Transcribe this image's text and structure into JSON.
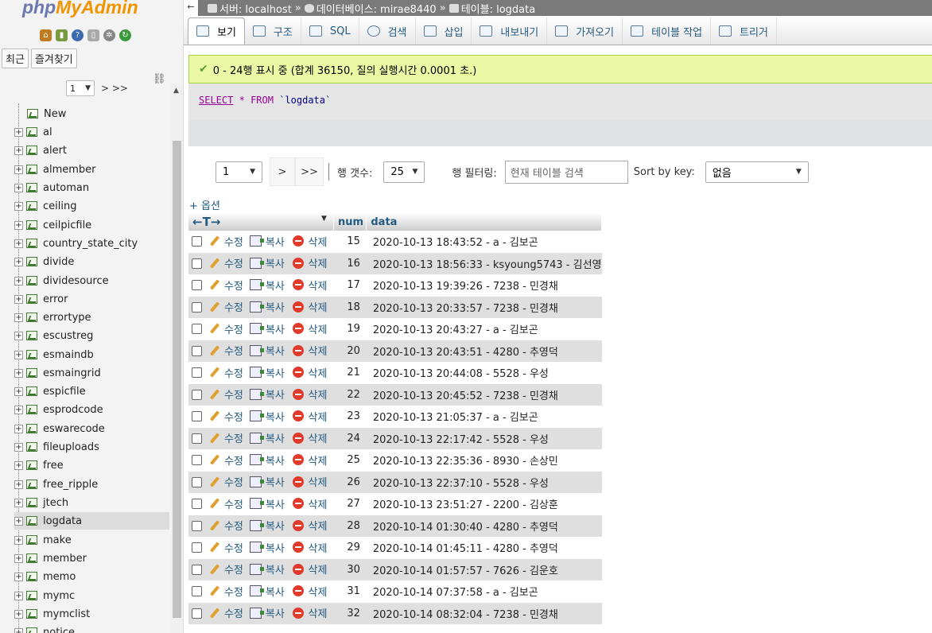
{
  "logo": {
    "php": "php",
    "myadmin": "MyAdmin"
  },
  "nav": {
    "tabs": [
      "최근",
      "즐겨찾기"
    ],
    "pager": {
      "page": "1",
      "next": "> >>"
    },
    "new_label": "New",
    "tables": [
      "al",
      "alert",
      "almember",
      "automan",
      "ceiling",
      "ceilpicfile",
      "country_state_city",
      "divide",
      "dividesource",
      "error",
      "errortype",
      "escustreg",
      "esmaindb",
      "esmaingrid",
      "espicfile",
      "esprodcode",
      "eswarecode",
      "fileuploads",
      "free",
      "free_ripple",
      "jtech",
      "logdata",
      "make",
      "member",
      "memo",
      "mymc",
      "mymclist",
      "notice"
    ],
    "active_table": "logdata"
  },
  "breadcrumb": {
    "back": "←",
    "server": "서버: localhost",
    "sep": "»",
    "database": "데이터베이스: mirae8440",
    "table": "테이블: logdata"
  },
  "tabs": [
    "보기",
    "구조",
    "SQL",
    "검색",
    "삽입",
    "내보내기",
    "가져오기",
    "테이블 작업",
    "트리거"
  ],
  "success": "0 - 24행 표시 중 (합계 36150, 질의 실행시간 0.0001 초.)",
  "sql": {
    "select": "SELECT",
    "star": "*",
    "from": "FROM",
    "table": "`logdata`"
  },
  "navrow": {
    "page": "1",
    "next": ">",
    "last": ">>",
    "rows_label": "행 갯수:",
    "rows_value": "25",
    "filter_label": "행 필터링:",
    "filter_placeholder": "현재 테이블 검색",
    "sort_label": "Sort by key:",
    "sort_value": "없음"
  },
  "options_label": "+ 옵션",
  "columns": {
    "arrows": "←T→",
    "num": "num",
    "data": "data"
  },
  "actions": {
    "edit": "수정",
    "copy": "복사",
    "delete": "삭제"
  },
  "rows": [
    {
      "num": "15",
      "data": "2020-10-13 18:43:52 - a - 김보곤"
    },
    {
      "num": "16",
      "data": "2020-10-13 18:56:33 - ksyoung5743 - 김선영"
    },
    {
      "num": "17",
      "data": "2020-10-13 19:39:26 - 7238 - 민경채"
    },
    {
      "num": "18",
      "data": "2020-10-13 20:33:57 - 7238 - 민경채"
    },
    {
      "num": "19",
      "data": "2020-10-13 20:43:27 - a - 김보곤"
    },
    {
      "num": "20",
      "data": "2020-10-13 20:43:51 - 4280 - 추영덕"
    },
    {
      "num": "21",
      "data": "2020-10-13 20:44:08 - 5528 - 우성"
    },
    {
      "num": "22",
      "data": "2020-10-13 20:45:52 - 7238 - 민경채"
    },
    {
      "num": "23",
      "data": "2020-10-13 21:05:37 - a - 김보곤"
    },
    {
      "num": "24",
      "data": "2020-10-13 22:17:42 - 5528 - 우성"
    },
    {
      "num": "25",
      "data": "2020-10-13 22:35:36 - 8930 - 손상민"
    },
    {
      "num": "26",
      "data": "2020-10-13 22:37:10 - 5528 - 우성"
    },
    {
      "num": "27",
      "data": "2020-10-13 23:51:27 - 2200 - 김상훈"
    },
    {
      "num": "28",
      "data": "2020-10-14 01:30:40 - 4280 - 추영덕"
    },
    {
      "num": "29",
      "data": "2020-10-14 01:45:11 - 4280 - 추영덕"
    },
    {
      "num": "30",
      "data": "2020-10-14 01:57:57 - 7626 - 김운호"
    },
    {
      "num": "31",
      "data": "2020-10-14 07:37:58 - a - 김보곤"
    },
    {
      "num": "32",
      "data": "2020-10-14 08:32:04 - 7238 - 민경채"
    }
  ],
  "colors": {
    "accent": "#235a81",
    "success_bg": "#ebf8a4",
    "stripe": "#dfdfdf"
  }
}
